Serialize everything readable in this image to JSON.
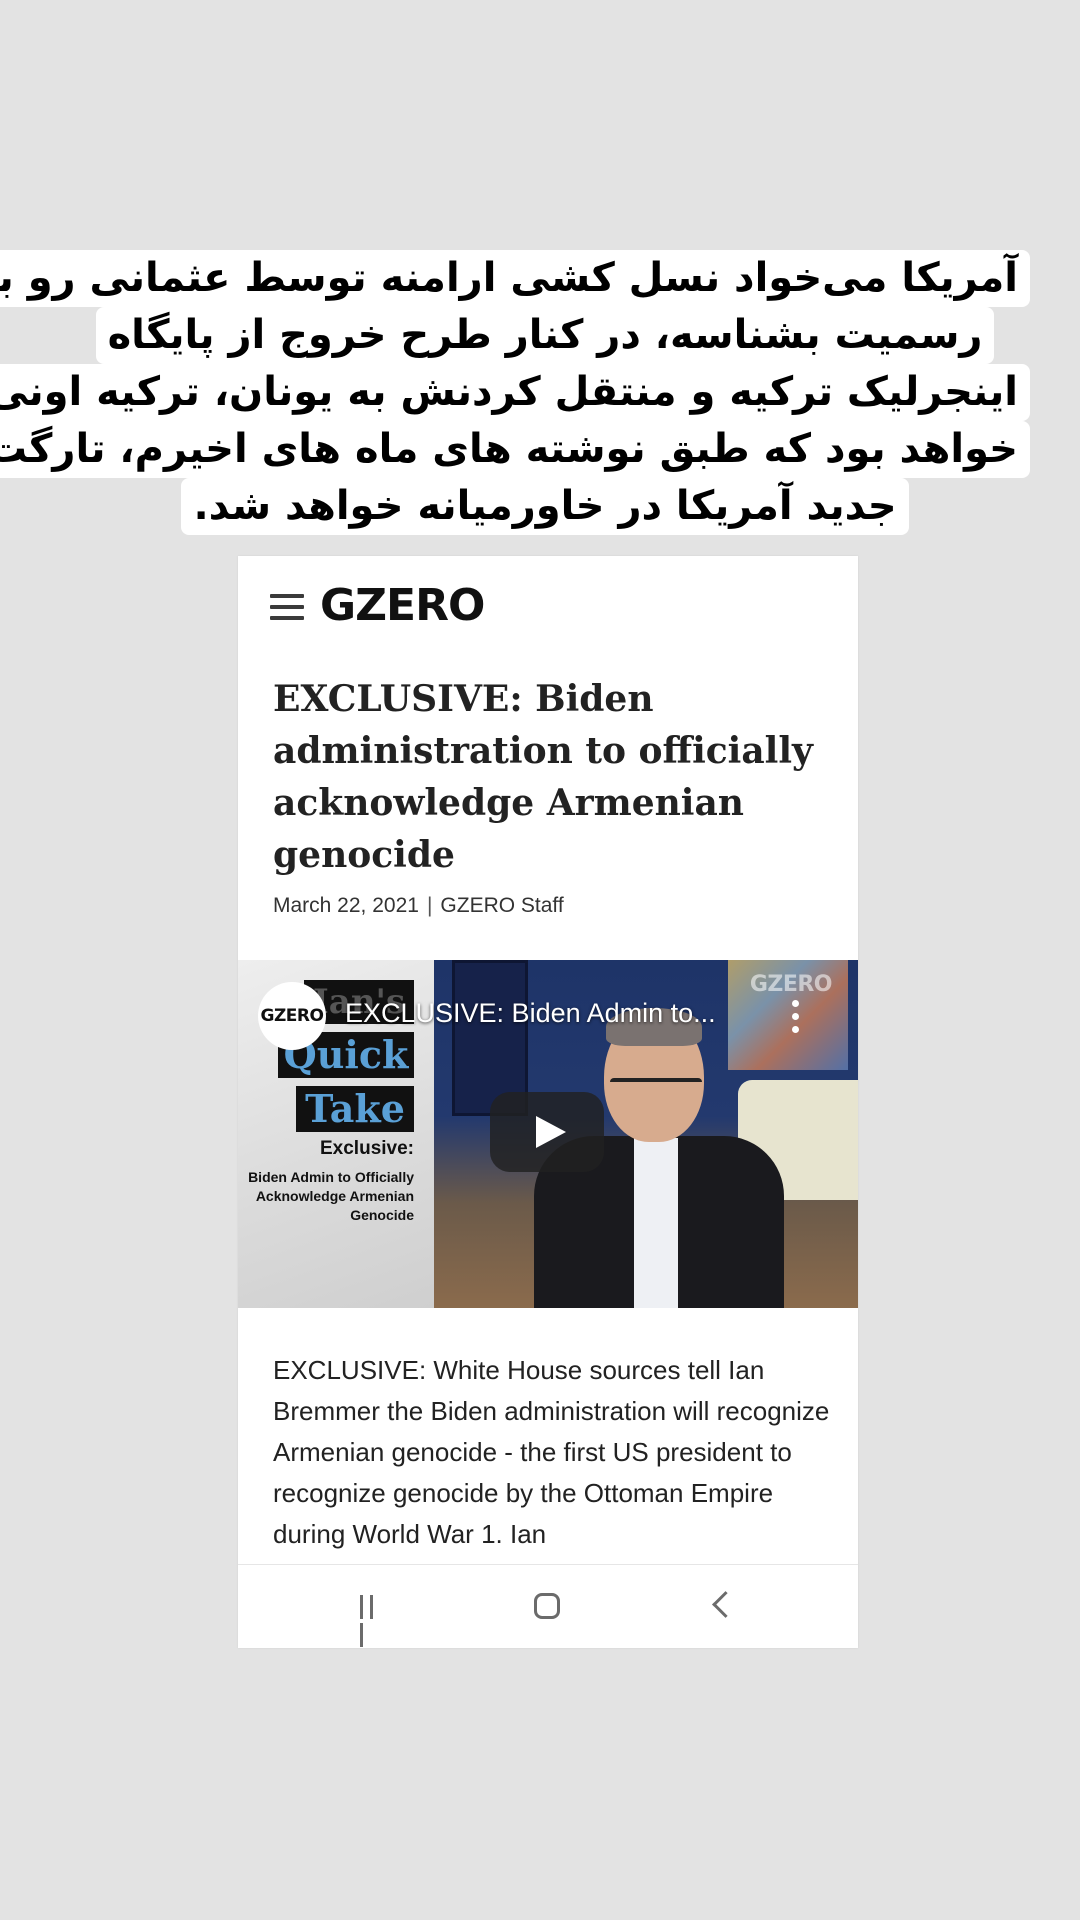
{
  "caption": {
    "lines": [
      "آمریکا می‌خواد نسل کشی ارامنه توسط عثمانی رو به",
      "رسمیت بشناسه، در کنار طرح خروج از پایگاه",
      "اینجرلیک ترکیه و منتقل کردنش به یونان، ترکیه اونی",
      "خواهد بود که طبق نوشته های ماه های اخیرم، تارگت",
      "جدید آمریکا در خاورمیانه خواهد شد."
    ]
  },
  "site": {
    "logo": "GZERO",
    "menu_icon": "hamburger-menu-icon"
  },
  "article": {
    "headline": "EXCLUSIVE: Biden administration to officially acknowledge Armenian genocide",
    "date": "March 22, 2021",
    "separator": "|",
    "author": "GZERO Staff",
    "body": "EXCLUSIVE: White House sources tell Ian Bremmer the Biden administration will recognize Armenian genocide - the first US president to recognize genocide by the Ottoman Empire during World War 1. Ian"
  },
  "video": {
    "channel_avatar_text": "GZERO",
    "title": "EXCLUSIVE: Biden Admin to...",
    "watermark": "GZERO",
    "thumbnail": {
      "line1": "Ian's",
      "line2": "Quick",
      "line3": "Take",
      "label": "Exclusive:",
      "subtitle": "Biden Admin to Officially Acknowledge Armenian Genocide"
    },
    "play_icon": "play-icon",
    "more_icon": "more-vert-icon"
  },
  "navbar": {
    "recents_icon": "recents-icon",
    "home_icon": "home-icon",
    "back_icon": "back-icon"
  },
  "colors": {
    "background": "#e3e3e3",
    "caption_bg": "#ffffff",
    "quick_take_blue": "#5aa0d6"
  }
}
